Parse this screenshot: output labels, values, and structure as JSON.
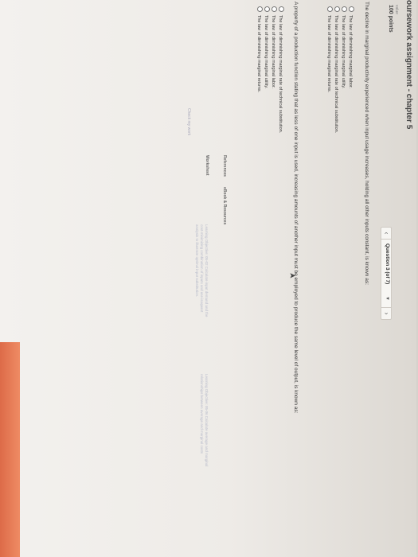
{
  "header": {
    "course_title": "oursework assignment - chapter 5",
    "value_label": "value",
    "points": "100 points"
  },
  "nav": {
    "prev_icon": "chevron-left-icon",
    "question_label": "Question 3 (of 7)",
    "dropdown_icon": "caret-down-icon",
    "next_icon": "chevron-right-icon"
  },
  "question1": {
    "text": "The decline in marginal productivity experienced when input usage increases, holding all other inputs constant, is known as:",
    "options": [
      "The law of diminishing marginal labor.",
      "The law of diminishing marginal utility.",
      "The law of diminishing marginal rate of technical substitution.",
      "The law of diminishing marginal returns."
    ]
  },
  "question2": {
    "text": "A property of a production function stating that as less of one input is used, increasing amounts of another input must be employed to produce the same level of output, is known as:",
    "options": [
      "The law of diminishing marginal rate of technical substitution.",
      "The law of diminishing marginal labor.",
      "The law of diminishing marginal utility.",
      "The law of diminishing marginal returns."
    ]
  },
  "tabs": {
    "references": "References",
    "ebook": "eBook & Resources",
    "worksheet": "Worksheet"
  },
  "learning_objectives": {
    "lo1": [
      "Learning Objective: 05-02 Calculate input demand and the",
      "cost-minimizing combination of inputs and use isoquant",
      "analysis to illustrate optimal input substitution."
    ],
    "lo2": [
      "Learning Objective: 05-06 Calculate average and marginal",
      "relationships between average and marginal costs"
    ]
  },
  "check_link": "Check my work"
}
